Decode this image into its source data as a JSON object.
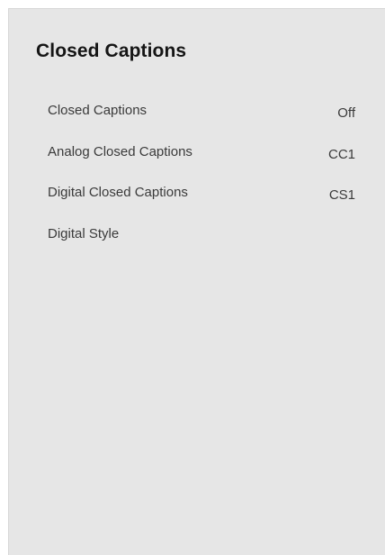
{
  "panel": {
    "title": "Closed Captions"
  },
  "menu": {
    "items": [
      {
        "label": "Closed Captions",
        "value": "Off"
      },
      {
        "label": "Analog Closed Captions",
        "value": "CC1"
      },
      {
        "label": "Digital Closed Captions",
        "value": "CS1"
      },
      {
        "label": "Digital Style",
        "value": ""
      }
    ]
  }
}
